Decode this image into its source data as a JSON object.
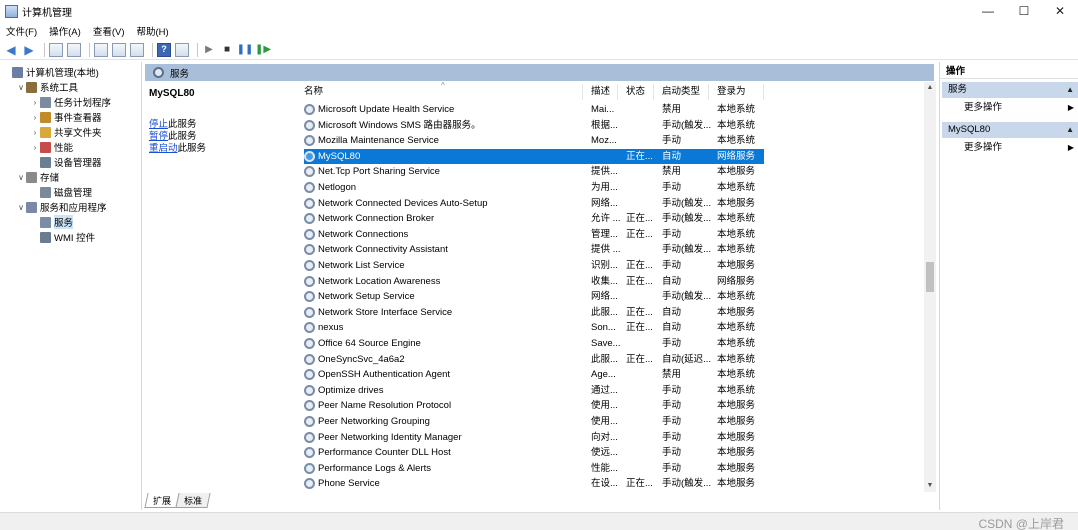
{
  "window": {
    "title": "计算机管理",
    "controls": [
      "—",
      "☐",
      "✕"
    ]
  },
  "menubar": [
    "文件(F)",
    "操作(A)",
    "查看(V)",
    "帮助(H)"
  ],
  "tree": [
    {
      "label": "计算机管理(本地)",
      "level": 0,
      "expander": "",
      "icon": "computer-icon",
      "icon_color": "#6b7fa3"
    },
    {
      "label": "系统工具",
      "level": 1,
      "expander": "∨",
      "icon": "tools-icon",
      "icon_color": "#8a6d3b"
    },
    {
      "label": "任务计划程序",
      "level": 2,
      "expander": "›",
      "icon": "clock-icon",
      "icon_color": "#7a8aa0"
    },
    {
      "label": "事件查看器",
      "level": 2,
      "expander": "›",
      "icon": "event-viewer-icon",
      "icon_color": "#c28b2a"
    },
    {
      "label": "共享文件夹",
      "level": 2,
      "expander": "›",
      "icon": "shared-folder-icon",
      "icon_color": "#d8a838"
    },
    {
      "label": "性能",
      "level": 2,
      "expander": "›",
      "icon": "performance-icon",
      "icon_color": "#c84b4b"
    },
    {
      "label": "设备管理器",
      "level": 2,
      "expander": "",
      "icon": "device-manager-icon",
      "icon_color": "#6a7f96"
    },
    {
      "label": "存储",
      "level": 1,
      "expander": "∨",
      "icon": "storage-icon",
      "icon_color": "#8a8a8a"
    },
    {
      "label": "磁盘管理",
      "level": 2,
      "expander": "",
      "icon": "disk-icon",
      "icon_color": "#7a8a9a"
    },
    {
      "label": "服务和应用程序",
      "level": 1,
      "expander": "∨",
      "icon": "services-apps-icon",
      "icon_color": "#7a8aa6"
    },
    {
      "label": "服务",
      "level": 2,
      "expander": "",
      "icon": "services-icon",
      "icon_color": "#7b8ca6",
      "selected": true
    },
    {
      "label": "WMI 控件",
      "level": 2,
      "expander": "",
      "icon": "wmi-icon",
      "icon_color": "#6c7c90"
    }
  ],
  "main": {
    "header": "服务",
    "selected_service": "MySQL80",
    "links": [
      {
        "link": "停止",
        "rest": "此服务"
      },
      {
        "link": "暂停",
        "rest": "此服务"
      },
      {
        "link": "重启动",
        "rest": "此服务"
      }
    ],
    "columns": [
      "名称",
      "描述",
      "状态",
      "启动类型",
      "登录为"
    ],
    "rows": [
      [
        "Microsoft Update Health Service",
        "Mai...",
        "",
        "禁用",
        "本地系统"
      ],
      [
        "Microsoft Windows SMS 路由器服务。",
        "根据...",
        "",
        "手动(触发...",
        "本地系统"
      ],
      [
        "Mozilla Maintenance Service",
        "Moz...",
        "",
        "手动",
        "本地系统"
      ],
      [
        "MySQL80",
        "",
        "正在...",
        "自动",
        "网络服务"
      ],
      [
        "Net.Tcp Port Sharing Service",
        "提供...",
        "",
        "禁用",
        "本地服务"
      ],
      [
        "Netlogon",
        "为用...",
        "",
        "手动",
        "本地系统"
      ],
      [
        "Network Connected Devices Auto-Setup",
        "网络...",
        "",
        "手动(触发...",
        "本地服务"
      ],
      [
        "Network Connection Broker",
        "允许 ...",
        "正在...",
        "手动(触发...",
        "本地系统"
      ],
      [
        "Network Connections",
        "管理...",
        "正在...",
        "手动",
        "本地系统"
      ],
      [
        "Network Connectivity Assistant",
        "提供 ...",
        "",
        "手动(触发...",
        "本地系统"
      ],
      [
        "Network List Service",
        "识别...",
        "正在...",
        "手动",
        "本地服务"
      ],
      [
        "Network Location Awareness",
        "收集...",
        "正在...",
        "自动",
        "网络服务"
      ],
      [
        "Network Setup Service",
        "网络...",
        "",
        "手动(触发...",
        "本地系统"
      ],
      [
        "Network Store Interface Service",
        "此服...",
        "正在...",
        "自动",
        "本地服务"
      ],
      [
        "nexus",
        "Son...",
        "正在...",
        "自动",
        "本地系统"
      ],
      [
        "Office 64 Source Engine",
        "Save...",
        "",
        "手动",
        "本地系统"
      ],
      [
        "OneSyncSvc_4a6a2",
        "此服...",
        "正在...",
        "自动(延迟...",
        "本地系统"
      ],
      [
        "OpenSSH Authentication Agent",
        "Age...",
        "",
        "禁用",
        "本地系统"
      ],
      [
        "Optimize drives",
        "通过...",
        "",
        "手动",
        "本地系统"
      ],
      [
        "Peer Name Resolution Protocol",
        "使用...",
        "",
        "手动",
        "本地服务"
      ],
      [
        "Peer Networking Grouping",
        "使用...",
        "",
        "手动",
        "本地服务"
      ],
      [
        "Peer Networking Identity Manager",
        "向对...",
        "",
        "手动",
        "本地服务"
      ],
      [
        "Performance Counter DLL Host",
        "使远...",
        "",
        "手动",
        "本地服务"
      ],
      [
        "Performance Logs & Alerts",
        "性能...",
        "",
        "手动",
        "本地服务"
      ],
      [
        "Phone Service",
        "在设...",
        "正在...",
        "手动(触发...",
        "本地服务"
      ]
    ],
    "selected_row": 3,
    "tabs": [
      "扩展",
      "标准"
    ]
  },
  "actions": {
    "header": "操作",
    "sections": [
      {
        "title": "服务",
        "item": "更多操作"
      },
      {
        "title": "MySQL80",
        "item": "更多操作"
      }
    ]
  },
  "watermark": "CSDN @上岸君",
  "colors": {
    "selected_row": "#0a78d7",
    "pane_header": "#a9bfd9",
    "action_section": "#c8d7ea",
    "link": "#1a4fd6"
  }
}
